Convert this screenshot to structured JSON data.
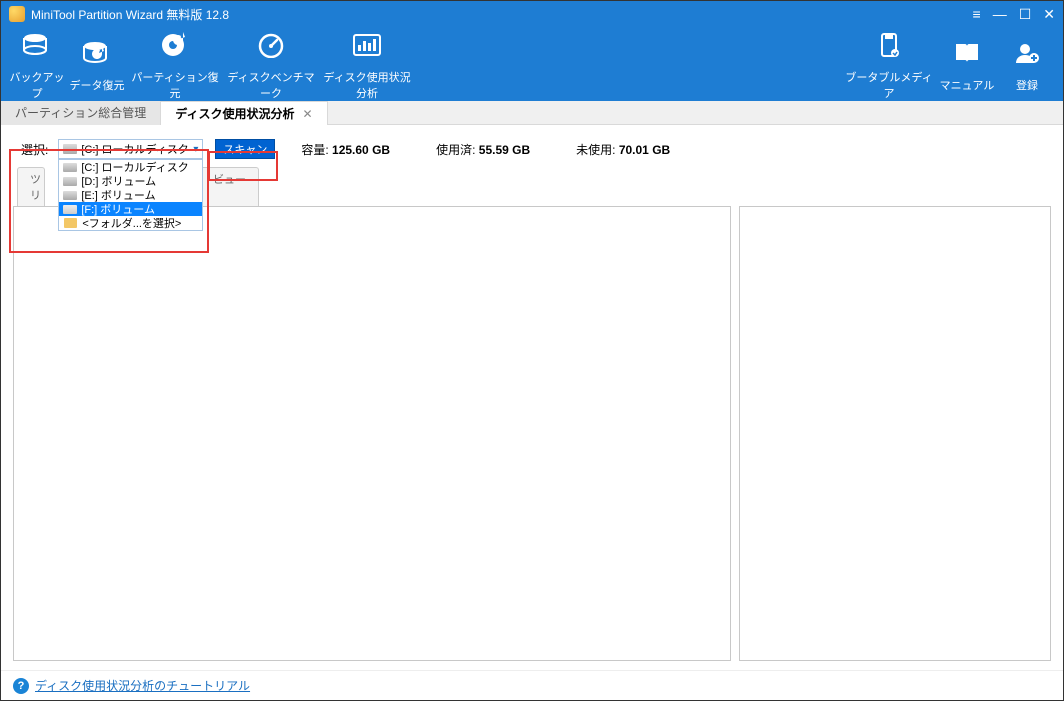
{
  "titlebar": {
    "title": "MiniTool Partition Wizard 無料版 12.8"
  },
  "toolbar": {
    "left": [
      {
        "key": "backup",
        "label": "バックアップ"
      },
      {
        "key": "recovery",
        "label": "データ復元"
      },
      {
        "key": "partition",
        "label": "パーティション復元"
      },
      {
        "key": "benchmark",
        "label": "ディスクベンチマーク"
      },
      {
        "key": "usage",
        "label": "ディスク使用状況分析"
      }
    ],
    "right": [
      {
        "key": "bootmedia",
        "label": "ブータブルメディア"
      },
      {
        "key": "manual",
        "label": "マニュアル"
      },
      {
        "key": "register",
        "label": "登録"
      }
    ]
  },
  "tabs": {
    "t1": "パーティション総合管理",
    "t2": "ディスク使用状況分析"
  },
  "controls": {
    "select_label": "選択:",
    "selected": "[C:] ローカルディスク",
    "options": [
      "[C:] ローカルディスク",
      "[D:] ボリューム",
      "[E:] ボリューム",
      "[F:] ボリューム",
      "<フォルダ...を選択>"
    ],
    "highlighted_index": 3,
    "scan_label": "スキャン",
    "capacity_label": "容量:",
    "capacity_value": "125.60 GB",
    "used_label": "使用済:",
    "used_value": "55.59 GB",
    "unused_label": "未使用:",
    "unused_value": "70.01 GB"
  },
  "view_tabs": {
    "tree": "ツリ",
    "file": "ビュー"
  },
  "footer": {
    "link": "ディスク使用状況分析のチュートリアル"
  }
}
